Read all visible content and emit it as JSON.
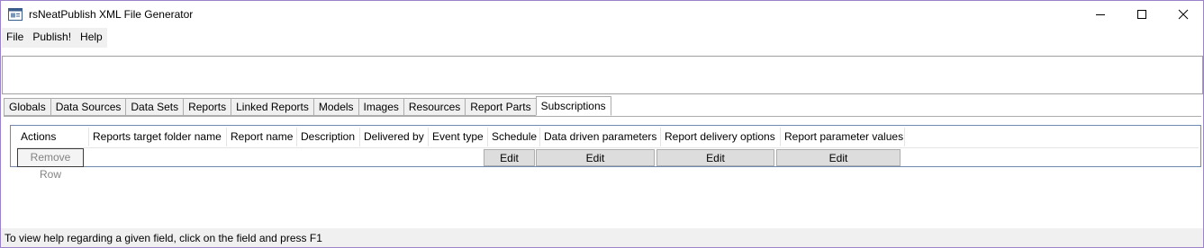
{
  "window": {
    "title": "rsNeatPublish XML File Generator"
  },
  "menu": {
    "items": [
      "File",
      "Publish!",
      "Help"
    ]
  },
  "tabs": [
    "Globals",
    "Data Sources",
    "Data Sets",
    "Reports",
    "Linked Reports",
    "Models",
    "Images",
    "Resources",
    "Report Parts",
    "Subscriptions"
  ],
  "active_tab": "Subscriptions",
  "grid": {
    "columns": [
      "Actions",
      "Reports target folder name",
      "Report name",
      "Description",
      "Delivered by",
      "Event type",
      "Schedule",
      "Data driven parameters",
      "Report delivery options",
      "Report parameter values"
    ],
    "row": {
      "remove_label": "Remove Row",
      "schedule_button": "Edit",
      "data_driven_button": "Edit",
      "delivery_options_button": "Edit",
      "parameter_values_button": "Edit"
    }
  },
  "status_bar": {
    "text": "To view help regarding a given field, click on the field and press F1"
  }
}
